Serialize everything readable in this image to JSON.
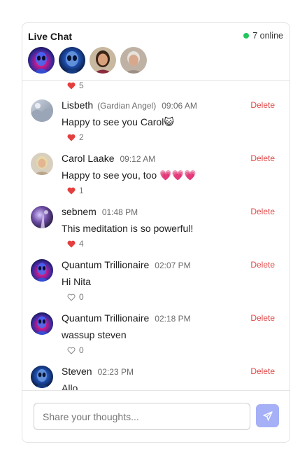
{
  "header": {
    "title": "Live Chat",
    "online_text": "7 online",
    "online_color": "#22c55e",
    "avatars": [
      "alien-blue-avatar",
      "alien-dark-avatar",
      "woman-avatar",
      "man-avatar"
    ]
  },
  "top_likes": {
    "count": "5",
    "liked": true
  },
  "messages": [
    {
      "name": "Lisbeth",
      "role": "(Gardian Angel)",
      "time": "09:06 AM",
      "text": "Happy to see you Carol😺",
      "likes": "2",
      "liked": true,
      "delete_label": "Delete"
    },
    {
      "name": "Carol Laake",
      "role": "",
      "time": "09:12 AM",
      "text": "Happy to see you, too 💗💗💗",
      "likes": "1",
      "liked": true,
      "delete_label": "Delete"
    },
    {
      "name": "sebnem",
      "role": "",
      "time": "01:48 PM",
      "text": "This meditation is so powerful!",
      "likes": "4",
      "liked": true,
      "delete_label": "Delete"
    },
    {
      "name": "Quantum Trillionaire",
      "role": "",
      "time": "02:07 PM",
      "text": "Hi Nita",
      "likes": "0",
      "liked": false,
      "delete_label": "Delete"
    },
    {
      "name": "Quantum Trillionaire",
      "role": "",
      "time": "02:18 PM",
      "text": "wassup steven",
      "likes": "0",
      "liked": false,
      "delete_label": "Delete"
    },
    {
      "name": "Steven",
      "role": "",
      "time": "02:23 PM",
      "text": "Allo",
      "likes": "",
      "liked": false,
      "delete_label": "Delete"
    }
  ],
  "composer": {
    "placeholder": "Share your thoughts...",
    "send_color": "#a5b0f7"
  },
  "colors": {
    "delete": "#e04848",
    "heart": "#e53e3e",
    "accent": "#a5b0f7"
  }
}
